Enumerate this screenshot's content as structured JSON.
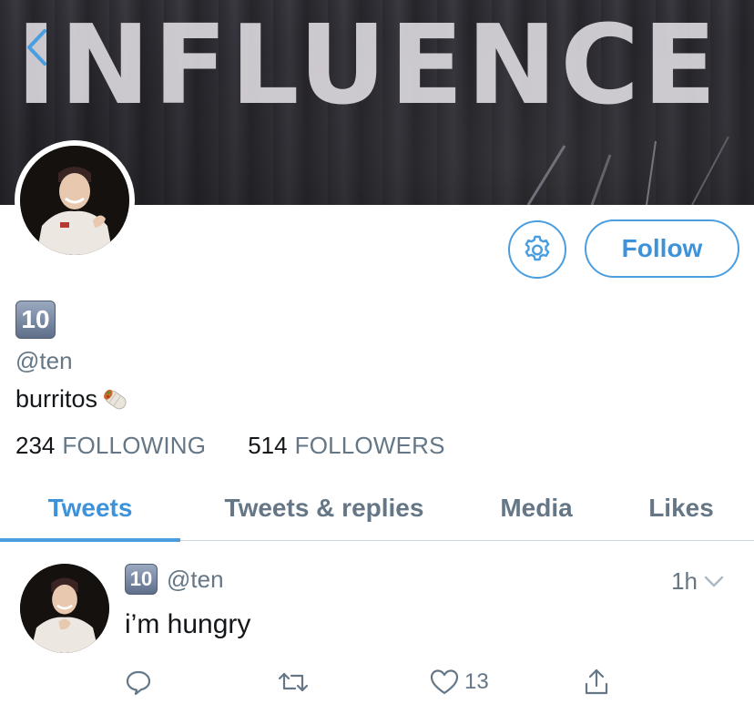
{
  "banner": {
    "text": "INFLUENCE"
  },
  "profile": {
    "display_name_emoji": "10",
    "handle": "@ten",
    "bio": "burritos",
    "bio_emoji_icon": "burrito-icon",
    "following_count": "234",
    "following_label": "FOLLOWING",
    "followers_count": "514",
    "followers_label": "FOLLOWERS"
  },
  "actions": {
    "settings_icon": "gear-icon",
    "follow_label": "Follow"
  },
  "tabs": [
    {
      "label": "Tweets",
      "active": true
    },
    {
      "label": "Tweets & replies",
      "active": false
    },
    {
      "label": "Media",
      "active": false
    },
    {
      "label": "Likes",
      "active": false
    }
  ],
  "tweet": {
    "name_emoji": "10",
    "handle": "@ten",
    "time": "1h",
    "text": "i’m hungry",
    "like_count": "13"
  },
  "colors": {
    "accent": "#4a9ee0",
    "secondary_text": "#657786",
    "primary_text": "#14171a"
  }
}
